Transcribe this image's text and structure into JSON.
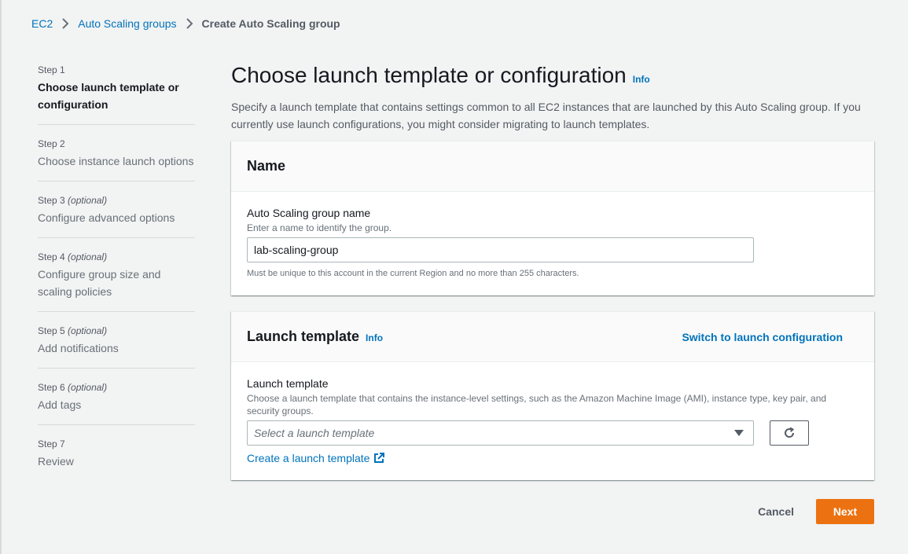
{
  "breadcrumb": {
    "items": [
      {
        "label": "EC2"
      },
      {
        "label": "Auto Scaling groups"
      },
      {
        "label": "Create Auto Scaling group"
      }
    ]
  },
  "steps": [
    {
      "num": "Step 1",
      "optional": "",
      "title": "Choose launch template or configuration",
      "active": true
    },
    {
      "num": "Step 2",
      "optional": "",
      "title": "Choose instance launch options"
    },
    {
      "num": "Step 3",
      "optional": "(optional)",
      "title": "Configure advanced options"
    },
    {
      "num": "Step 4",
      "optional": "(optional)",
      "title": "Configure group size and scaling policies"
    },
    {
      "num": "Step 5",
      "optional": "(optional)",
      "title": "Add notifications"
    },
    {
      "num": "Step 6",
      "optional": "(optional)",
      "title": "Add tags"
    },
    {
      "num": "Step 7",
      "optional": "",
      "title": "Review"
    }
  ],
  "page": {
    "title": "Choose launch template or configuration",
    "info": "Info",
    "description": "Specify a launch template that contains settings common to all EC2 instances that are launched by this Auto Scaling group. If you currently use launch configurations, you might consider migrating to launch templates."
  },
  "name_panel": {
    "title": "Name",
    "field_label": "Auto Scaling group name",
    "field_desc": "Enter a name to identify the group.",
    "value": "lab-scaling-group",
    "constraint": "Must be unique to this account in the current Region and no more than 255 characters."
  },
  "template_panel": {
    "title": "Launch template",
    "info": "Info",
    "switch_label": "Switch to launch configuration",
    "field_label": "Launch template",
    "field_desc": "Choose a launch template that contains the instance-level settings, such as the Amazon Machine Image (AMI), instance type, key pair, and security groups.",
    "select_placeholder": "Select a launch template",
    "create_link": "Create a launch template"
  },
  "actions": {
    "cancel": "Cancel",
    "next": "Next"
  },
  "colors": {
    "link": "#0073bb",
    "primary": "#ec7211",
    "background": "#f2f3f3"
  }
}
